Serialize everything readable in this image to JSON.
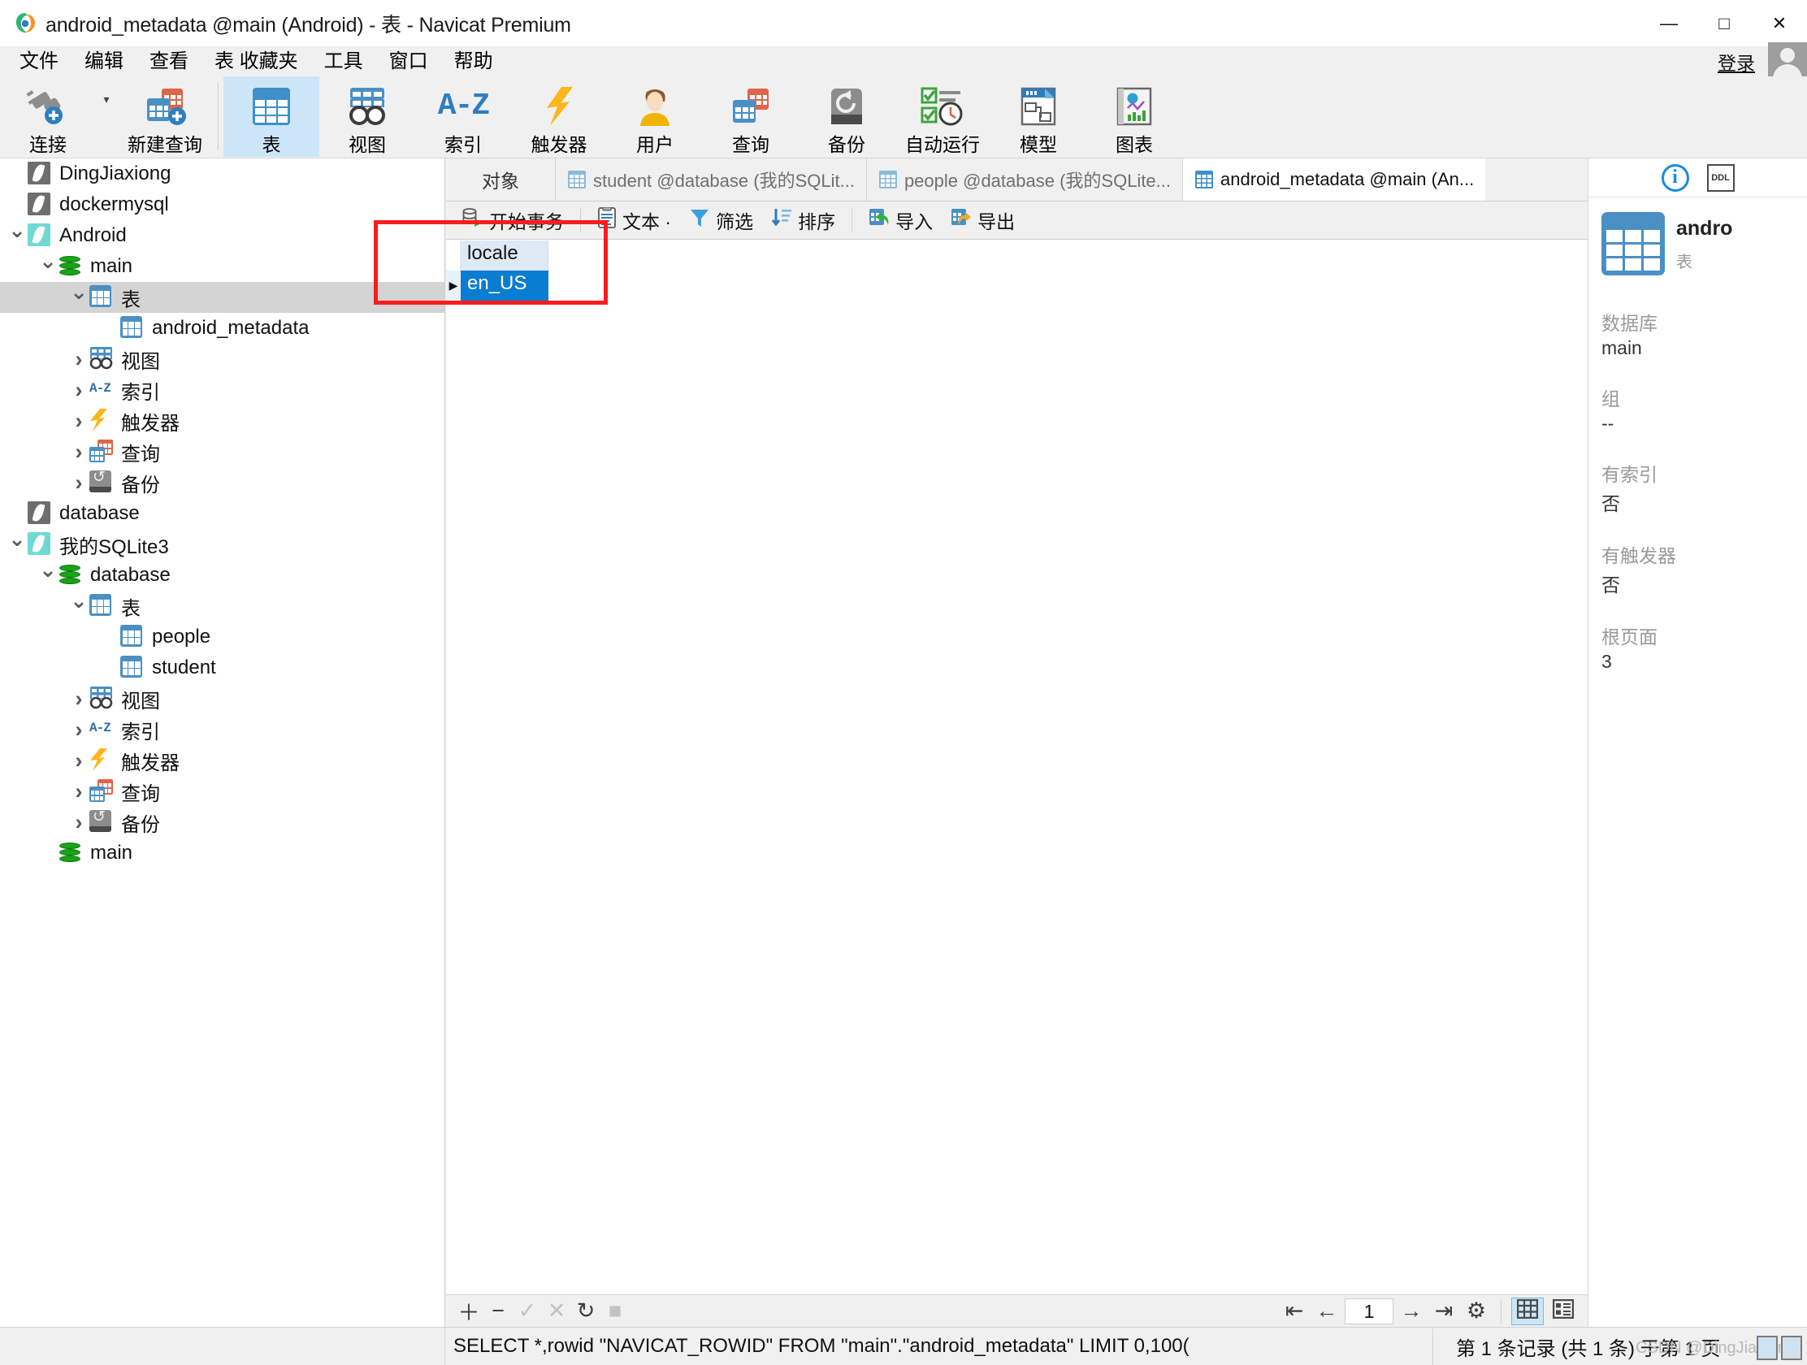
{
  "window": {
    "title": "android_metadata @main (Android) - 表 - Navicat Premium",
    "minimize": "—",
    "maximize": "□",
    "close": "✕"
  },
  "menubar": {
    "items": [
      "文件",
      "编辑",
      "查看",
      "表 收藏夹",
      "工具",
      "窗口",
      "帮助"
    ],
    "login_label": "登录"
  },
  "toolbar": {
    "buttons": [
      {
        "label": "连接",
        "icon": "connection-icon",
        "selected": false
      },
      {
        "label": "新建查询",
        "icon": "new-query-icon",
        "selected": false
      },
      {
        "label": "表",
        "icon": "table-icon",
        "selected": true
      },
      {
        "label": "视图",
        "icon": "view-icon",
        "selected": false
      },
      {
        "label": "索引",
        "icon": "index-az-icon",
        "selected": false
      },
      {
        "label": "触发器",
        "icon": "trigger-bolt-icon",
        "selected": false
      },
      {
        "label": "用户",
        "icon": "user-icon",
        "selected": false
      },
      {
        "label": "查询",
        "icon": "query-icon",
        "selected": false
      },
      {
        "label": "备份",
        "icon": "backup-icon",
        "selected": false
      },
      {
        "label": "自动运行",
        "icon": "automation-icon",
        "selected": false
      },
      {
        "label": "模型",
        "icon": "model-icon",
        "selected": false
      },
      {
        "label": "图表",
        "icon": "chart-icon",
        "selected": false
      }
    ]
  },
  "sidebar": {
    "items": [
      {
        "label": "DingJiaxiong",
        "indent": 0,
        "icon": "sqlite-gray-icon",
        "twisty": "none",
        "selected": false
      },
      {
        "label": "dockermysql",
        "indent": 0,
        "icon": "sqlite-gray-icon",
        "twisty": "none",
        "selected": false
      },
      {
        "label": "Android",
        "indent": 0,
        "icon": "sqlite-teal-icon",
        "twisty": "open",
        "selected": false
      },
      {
        "label": "main",
        "indent": 1,
        "icon": "database-icon",
        "twisty": "open",
        "selected": false
      },
      {
        "label": "表",
        "indent": 2,
        "icon": "grid-table-icon",
        "twisty": "open",
        "selected": true
      },
      {
        "label": "android_metadata",
        "indent": 3,
        "icon": "grid-table-icon",
        "twisty": "none",
        "selected": false
      },
      {
        "label": "视图",
        "indent": 2,
        "icon": "view-icon",
        "twisty": "closed",
        "selected": false
      },
      {
        "label": "索引",
        "indent": 2,
        "icon": "index-az-icon",
        "twisty": "closed",
        "selected": false
      },
      {
        "label": "触发器",
        "indent": 2,
        "icon": "trigger-bolt-icon",
        "twisty": "closed",
        "selected": false
      },
      {
        "label": "查询",
        "indent": 2,
        "icon": "query-icon",
        "twisty": "closed",
        "selected": false
      },
      {
        "label": "备份",
        "indent": 2,
        "icon": "backup-icon",
        "twisty": "closed",
        "selected": false
      },
      {
        "label": "database",
        "indent": 0,
        "icon": "sqlite-gray-icon",
        "twisty": "none",
        "selected": false
      },
      {
        "label": "我的SQLite3",
        "indent": 0,
        "icon": "sqlite-teal-icon",
        "twisty": "open",
        "selected": false
      },
      {
        "label": "database",
        "indent": 1,
        "icon": "database-icon",
        "twisty": "open",
        "selected": false
      },
      {
        "label": "表",
        "indent": 2,
        "icon": "grid-table-icon",
        "twisty": "open",
        "selected": false
      },
      {
        "label": "people",
        "indent": 3,
        "icon": "grid-table-icon",
        "twisty": "none",
        "selected": false
      },
      {
        "label": "student",
        "indent": 3,
        "icon": "grid-table-icon",
        "twisty": "none",
        "selected": false
      },
      {
        "label": "视图",
        "indent": 2,
        "icon": "view-icon",
        "twisty": "closed",
        "selected": false
      },
      {
        "label": "索引",
        "indent": 2,
        "icon": "index-az-icon",
        "twisty": "closed",
        "selected": false
      },
      {
        "label": "触发器",
        "indent": 2,
        "icon": "trigger-bolt-icon",
        "twisty": "closed",
        "selected": false
      },
      {
        "label": "查询",
        "indent": 2,
        "icon": "query-icon",
        "twisty": "closed",
        "selected": false
      },
      {
        "label": "备份",
        "indent": 2,
        "icon": "backup-icon",
        "twisty": "closed",
        "selected": false
      },
      {
        "label": "main",
        "indent": 1,
        "icon": "database-icon",
        "twisty": "none",
        "selected": false
      }
    ]
  },
  "tabbar": {
    "object_tab": "对象",
    "tabs": [
      {
        "label": "student @database (我的SQLit...",
        "active": false
      },
      {
        "label": "people @database (我的SQLite...",
        "active": false
      },
      {
        "label": "android_metadata @main (An...",
        "active": true
      }
    ]
  },
  "grid_toolbar": {
    "buttons": [
      {
        "label": "开始事务",
        "icon": "begin-transaction-icon"
      },
      {
        "label": "文本 ·",
        "icon": "text-icon"
      },
      {
        "label": "筛选",
        "icon": "filter-icon"
      },
      {
        "label": "排序",
        "icon": "sort-icon"
      },
      {
        "label": "导入",
        "icon": "import-icon"
      },
      {
        "label": "导出",
        "icon": "export-icon"
      }
    ]
  },
  "datagrid": {
    "columns": [
      "locale"
    ],
    "rows": [
      {
        "marker": "▶",
        "cells": [
          "en_US"
        ],
        "selected": true
      }
    ]
  },
  "info_panel": {
    "tab_info": "i",
    "tab_ddl": "DDL",
    "object_name": "andro",
    "object_type": "表",
    "properties": [
      {
        "key": "数据库",
        "value": "main"
      },
      {
        "key": "组",
        "value": "--"
      },
      {
        "key": "有索引",
        "value": "否"
      },
      {
        "key": "有触发器",
        "value": "否"
      },
      {
        "key": "根页面",
        "value": "3"
      }
    ]
  },
  "grid_footer": {
    "add": "＋",
    "remove": "−",
    "confirm": "✓",
    "cancel": "✕",
    "refresh": "↻",
    "stop": "■",
    "first_page": "⇤",
    "prev_page": "←",
    "page_number": "1",
    "next_page": "→",
    "last_page": "⇥",
    "settings": "⚙",
    "view_grid": "grid-view-icon",
    "view_form": "form-view-icon"
  },
  "statusbar": {
    "sql": "SELECT *,rowid \"NAVICAT_ROWID\" FROM \"main\".\"android_metadata\" LIMIT 0,100(",
    "record_info": "第 1 条记录 (共 1 条) 于第 1 页",
    "watermark": "CSDN @DingJiaxiong"
  },
  "colors": {
    "accent_blue": "#0a7cd1",
    "selection_header": "#ddeaf5",
    "toolbar_selected": "#cce6f7",
    "annotation_red": "#f91c1c",
    "tree_selected": "#d4d4d4"
  }
}
